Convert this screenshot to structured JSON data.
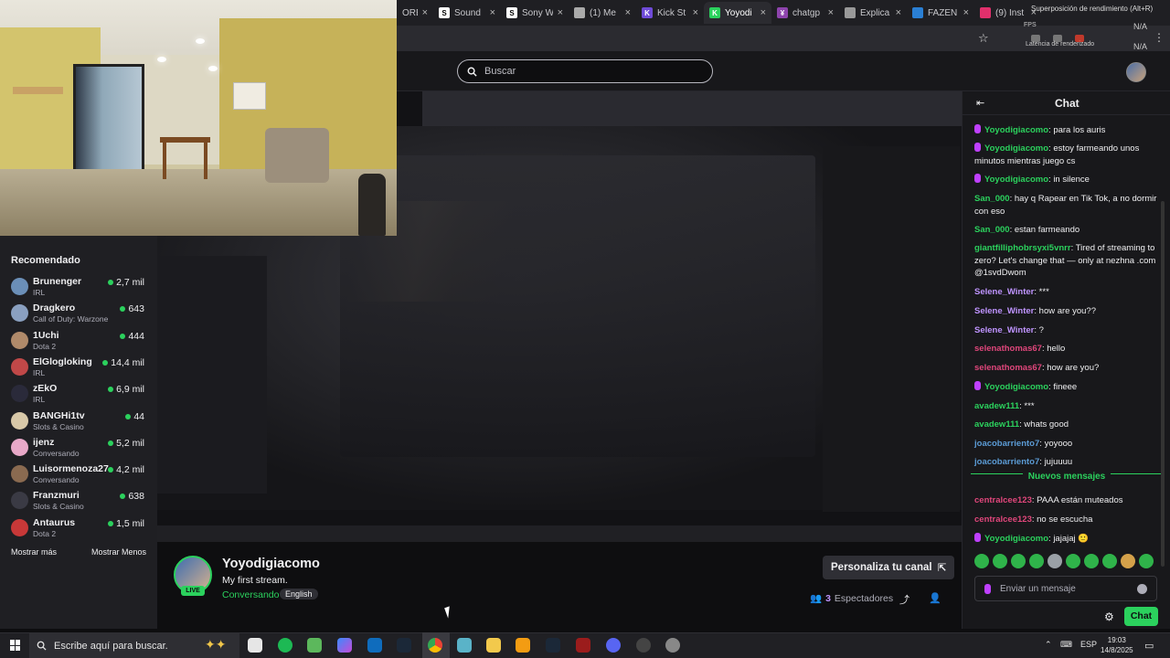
{
  "browser": {
    "tabs": [
      {
        "label": "ORE",
        "color": "#444"
      },
      {
        "label": "Sound",
        "color": "#ffffff",
        "fav_text": "S"
      },
      {
        "label": "Sony W",
        "color": "#ffffff",
        "fav_text": "S"
      },
      {
        "label": "(1) Me",
        "color": "#aaaaaa"
      },
      {
        "label": "Kick St",
        "color": "#6f4bd8",
        "fav_text": "K"
      },
      {
        "label": "Yoyodi",
        "color": "#2bd15d",
        "fav_text": "K",
        "active": true
      },
      {
        "label": "chatgp",
        "color": "#8e44ad",
        "fav_text": "¥"
      },
      {
        "label": "Explica",
        "color": "#999999"
      },
      {
        "label": "FAZEN",
        "color": "#2a7fd4"
      },
      {
        "label": "(9) Inst",
        "color": "#e1306c"
      }
    ],
    "overlay_label": "Superposición de rendimiento (Alt+R)",
    "perf": {
      "fps": "FPS",
      "latency": "Latencia de renderizado",
      "na_top": "N/A",
      "na_bottom": "N/A"
    }
  },
  "header": {
    "search_placeholder": "Buscar"
  },
  "sidebar": {
    "title": "Recomendado",
    "items": [
      {
        "name": "Brunenger",
        "game": "IRL",
        "viewers": "2,7 mil",
        "color": "#6b8fb8"
      },
      {
        "name": "Dragkero",
        "game": "Call of Duty: Warzone",
        "viewers": "643",
        "color": "#8aa0c0"
      },
      {
        "name": "1Uchi",
        "game": "Dota 2",
        "viewers": "444",
        "color": "#b08a6a"
      },
      {
        "name": "ElGlogloking",
        "game": "IRL",
        "viewers": "14,4 mil",
        "color": "#c04848"
      },
      {
        "name": "zEkO",
        "game": "IRL",
        "viewers": "6,9 mil",
        "color": "#2a2a3a"
      },
      {
        "name": "BANGHi1tv",
        "game": "Slots & Casino",
        "viewers": "44",
        "color": "#d8c8a8"
      },
      {
        "name": "ijenz",
        "game": "Conversando",
        "viewers": "5,2 mil",
        "color": "#e8a8c8"
      },
      {
        "name": "Luisormenoza27",
        "game": "Conversando",
        "viewers": "4,2 mil",
        "color": "#8a6a50"
      },
      {
        "name": "Franzmuri",
        "game": "Slots & Casino",
        "viewers": "638",
        "color": "#3a3a44"
      },
      {
        "name": "Antaurus",
        "game": "Dota 2",
        "viewers": "1,5 mil",
        "color": "#c83838"
      }
    ],
    "show_more": "Mostrar más",
    "show_less": "Mostrar Menos"
  },
  "channel": {
    "live": "LIVE",
    "name": "Yoyodigiacomo",
    "title": "My first stream.",
    "category": "Conversando",
    "tag": "English",
    "customize": "Personaliza tu canal",
    "viewers_count": "3",
    "viewers_label": "Espectadores"
  },
  "chat": {
    "title": "Chat",
    "messages": [
      {
        "user": "Yoyodigiacomo",
        "text": "para los auris",
        "color": "#2bd15d",
        "mic": true
      },
      {
        "user": "Yoyodigiacomo",
        "text": "estoy farmeando unos minutos mientras juego cs",
        "color": "#2bd15d",
        "mic": true
      },
      {
        "user": "Yoyodigiacomo",
        "text": "in silence",
        "color": "#2bd15d",
        "mic": true
      },
      {
        "user": "San_000",
        "text": "hay q Rapear en Tik Tok, a no dormir con eso",
        "color": "#2bd15d",
        "mic": false
      },
      {
        "user": "San_000",
        "text": "estan farmeando",
        "color": "#2bd15d",
        "mic": false
      },
      {
        "user": "giantfilliphobrsyxi5vnrr",
        "text": "Tired of streaming to zero? Let's change that — only at nezhna .com @1svdDwom",
        "color": "#2bd15d",
        "mic": false
      },
      {
        "user": "Selene_Winter",
        "text": "***",
        "color": "#bf94ff",
        "mic": false
      },
      {
        "user": "Selene_Winter",
        "text": "how are you??",
        "color": "#bf94ff",
        "mic": false
      },
      {
        "user": "Selene_Winter",
        "text": "?",
        "color": "#bf94ff",
        "mic": false
      },
      {
        "user": "selenathomas67",
        "text": "hello",
        "color": "#e0467b",
        "mic": false
      },
      {
        "user": "selenathomas67",
        "text": "how are you?",
        "color": "#e0467b",
        "mic": false
      },
      {
        "user": "Yoyodigiacomo",
        "text": "fineee",
        "color": "#2bd15d",
        "mic": true
      },
      {
        "user": "avadew111",
        "text": "***",
        "color": "#2bd15d",
        "mic": false
      },
      {
        "user": "avadew111",
        "text": "whats good",
        "color": "#2bd15d",
        "mic": false
      },
      {
        "user": "joacobarriento7",
        "text": "yoyooo",
        "color": "#5b9bd5",
        "mic": false
      },
      {
        "user": "joacobarriento7",
        "text": "jujuuuu",
        "color": "#5b9bd5",
        "mic": false
      },
      {
        "user": "centralcee123",
        "text": "PAAA están muteados",
        "color": "#e0467b",
        "mic": false
      },
      {
        "user": "centralcee123",
        "text": "no se escucha",
        "color": "#e0467b",
        "mic": false
      },
      {
        "user": "Yoyodigiacomo",
        "text": "jajajaj 🙂",
        "color": "#2bd15d",
        "mic": true
      }
    ],
    "new_messages": "Nuevos mensajes",
    "input_placeholder": "Enviar un mensaje",
    "send_button": "Chat"
  },
  "taskbar": {
    "search_placeholder": "Escribe aquí para buscar.",
    "lang": "ESP",
    "time": "19:03",
    "date": "14/8/2025"
  },
  "colors": {
    "accent": "#2bd15d",
    "bg": "#0e0e10",
    "panel": "#18181b"
  }
}
